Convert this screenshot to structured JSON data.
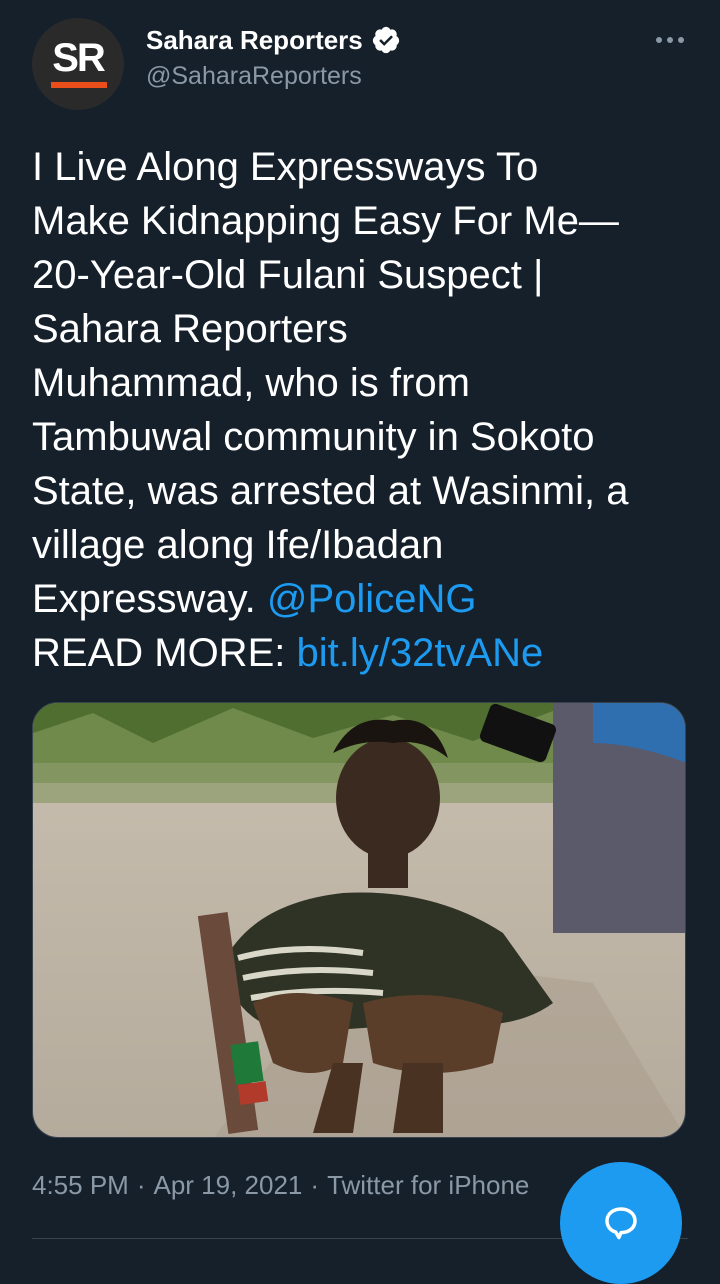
{
  "account": {
    "avatar_text": "SR",
    "display_name": "Sahara Reporters",
    "handle": "@SaharaReporters",
    "verified": true
  },
  "tweet": {
    "lines": [
      "I Live Along Expressways To",
      "Make Kidnapping Easy For Me—",
      "20-Year-Old Fulani Suspect |",
      "Sahara Reporters",
      "Muhammad, who is from",
      "Tambuwal community in Sokoto",
      "State, was arrested at Wasinmi, a",
      "village along Ife/Ibadan"
    ],
    "line9_text": "Expressway. ",
    "mention": "@PoliceNG",
    "read_more_label": "READ MORE: ",
    "link": "bit.ly/32tvANe"
  },
  "meta": {
    "time": "4:55 PM",
    "date": "Apr 19, 2021",
    "source": "Twitter for iPhone",
    "separator": "·"
  },
  "icons": {
    "verified": "verified-badge-icon",
    "more": "more-options-icon",
    "compose": "reply-bubble-icon"
  },
  "colors": {
    "background": "#15202b",
    "link": "#1d9bf0",
    "secondary_text": "#8b98a5",
    "brand_accent": "#e94e1b"
  }
}
